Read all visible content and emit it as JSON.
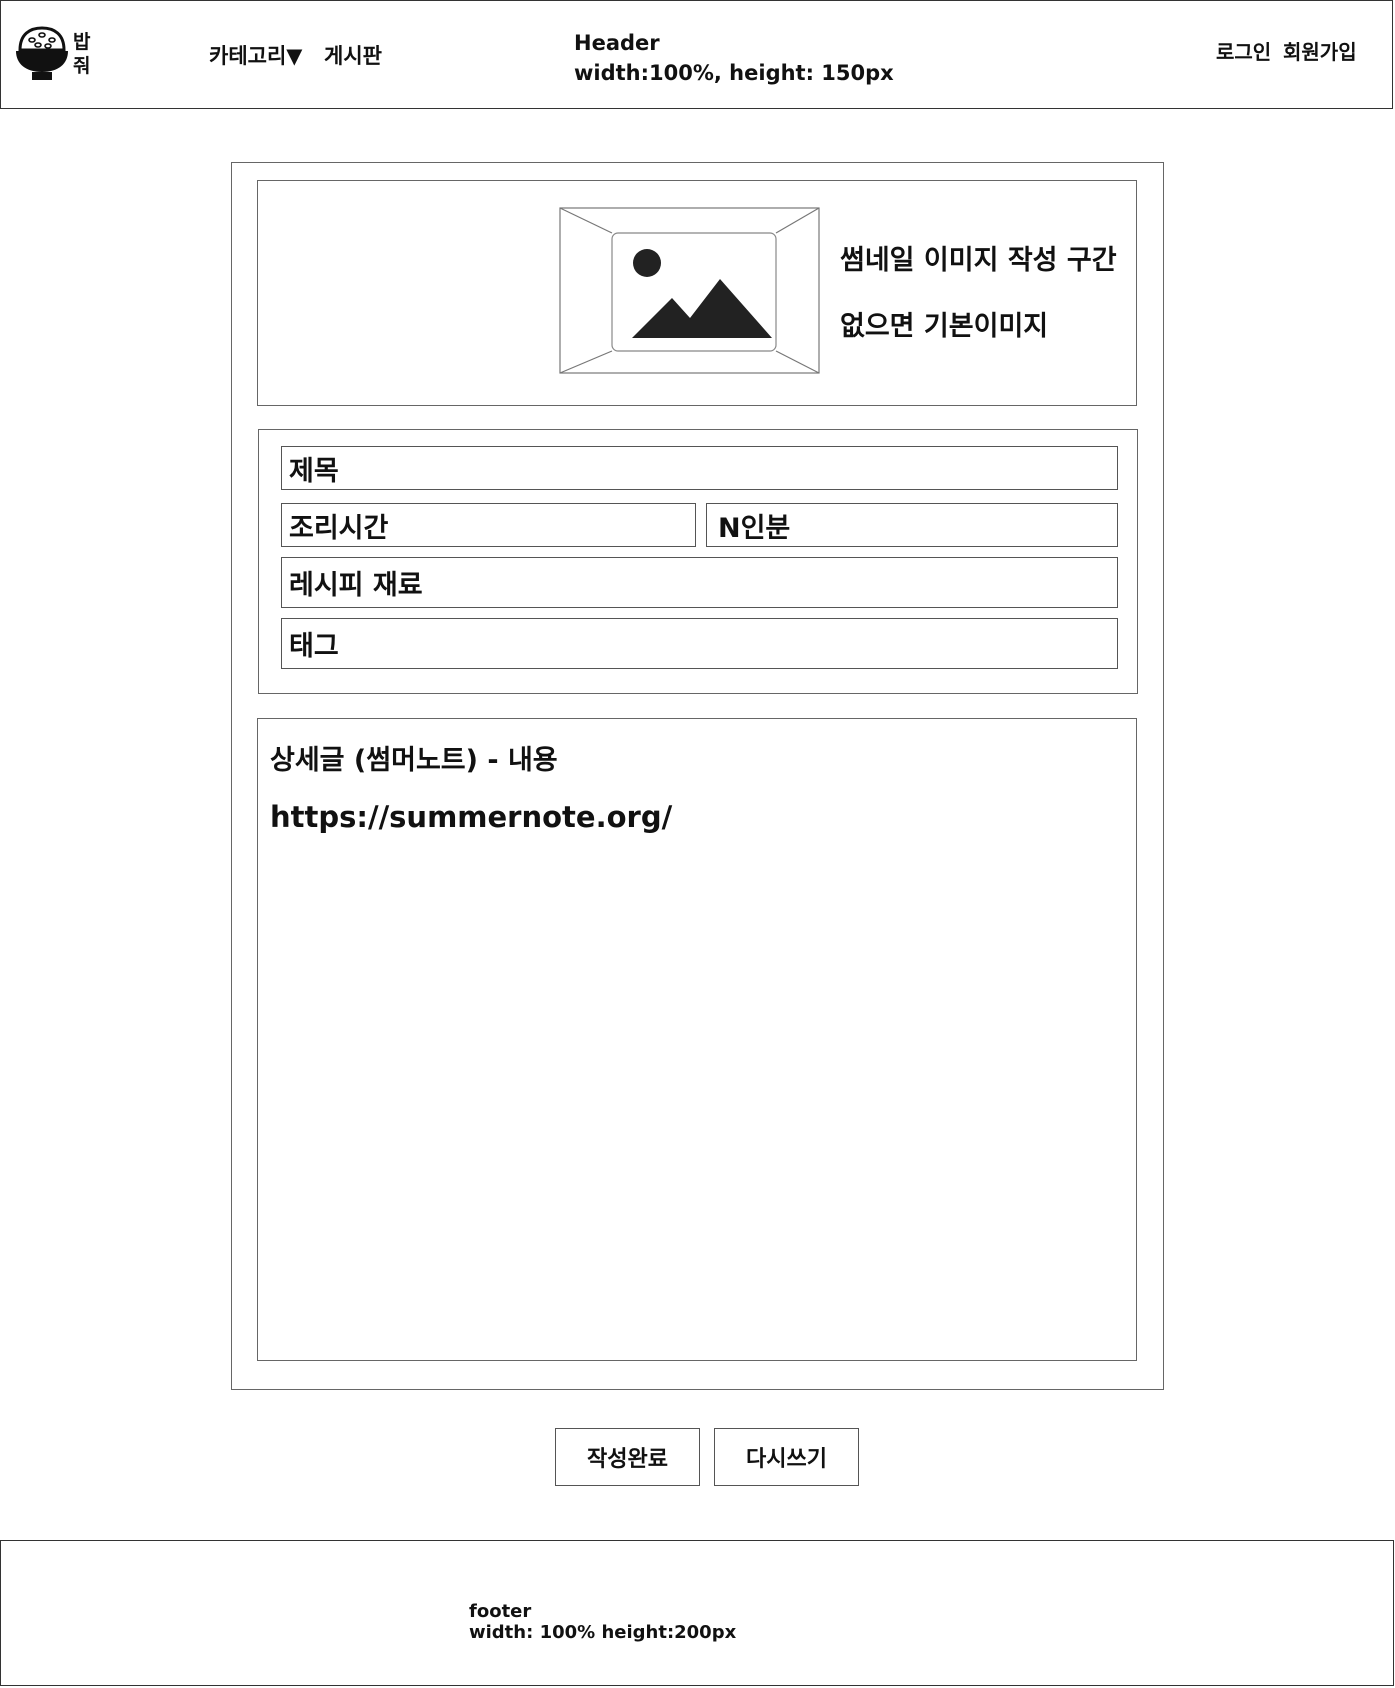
{
  "header": {
    "logo_text": "밥 줘",
    "nav_category": "카테고리▼",
    "nav_board": "게시판",
    "note_line1": "Header",
    "note_line2": "width:100%, height: 150px",
    "login": "로그인",
    "signup": "회원가입"
  },
  "thumbnail": {
    "icon": "image-placeholder-icon",
    "line1": "썸네일 이미지 작성 구간",
    "line2": "없으면 기본이미지"
  },
  "form": {
    "title": "제목",
    "cook_time": "조리시간",
    "servings": "N인분",
    "ingredients": "레시피 재료",
    "tags": "태그"
  },
  "content": {
    "label": "상세글 (썸머노트) - 내용",
    "link": "https://summernote.org/"
  },
  "buttons": {
    "submit": "작성완료",
    "rewrite": "다시쓰기"
  },
  "footer": {
    "line1": "footer",
    "line2": "width: 100% height:200px"
  }
}
